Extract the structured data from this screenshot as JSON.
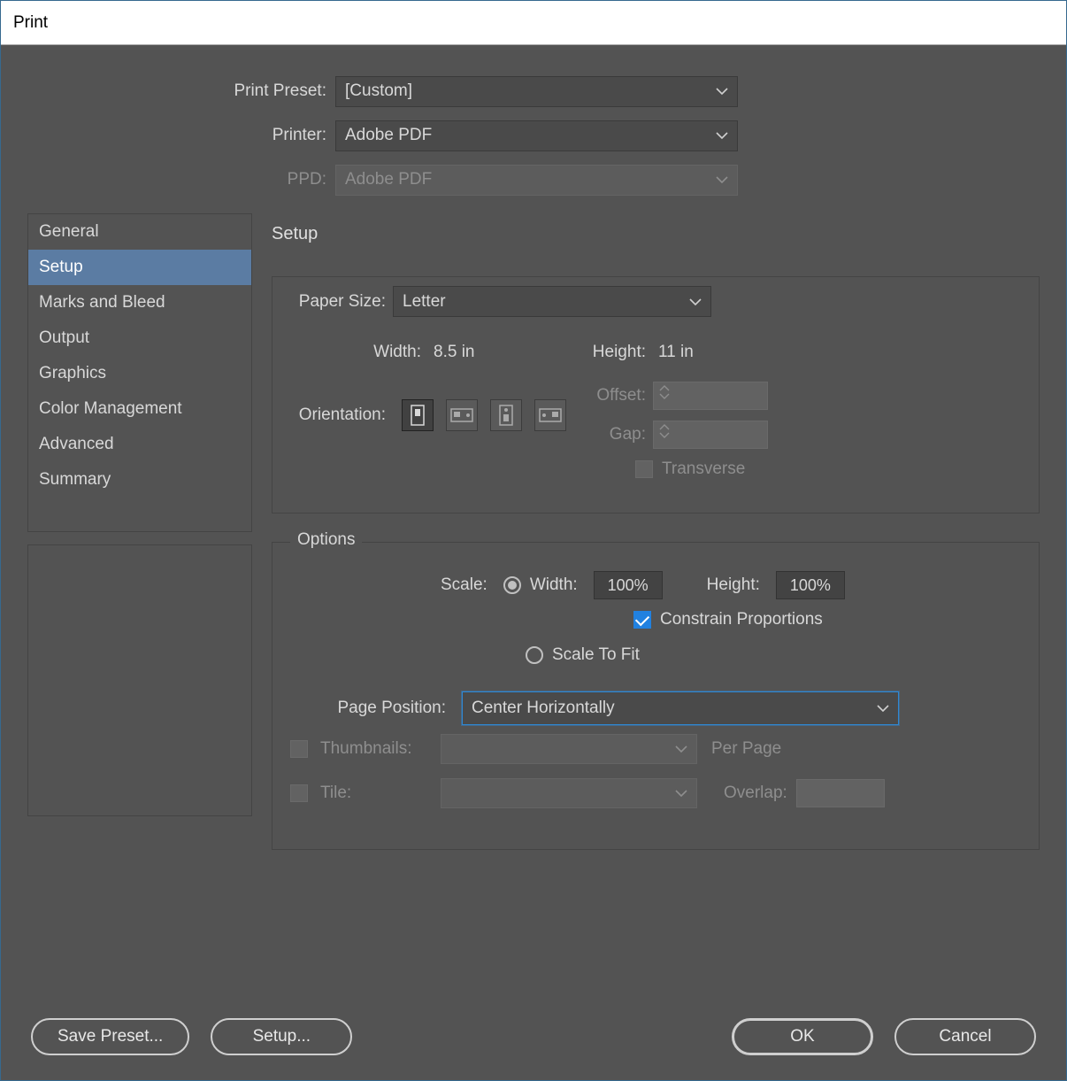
{
  "window": {
    "title": "Print"
  },
  "top": {
    "preset_label": "Print Preset:",
    "preset_value": "[Custom]",
    "printer_label": "Printer:",
    "printer_value": "Adobe PDF",
    "ppd_label": "PPD:",
    "ppd_value": "Adobe PDF"
  },
  "sidebar": {
    "items": [
      "General",
      "Setup",
      "Marks and Bleed",
      "Output",
      "Graphics",
      "Color Management",
      "Advanced",
      "Summary"
    ],
    "selected_index": 1
  },
  "panel": {
    "title": "Setup"
  },
  "setup": {
    "paper_size_label": "Paper Size:",
    "paper_size_value": "Letter",
    "width_label": "Width:",
    "width_value": "8.5 in",
    "height_label": "Height:",
    "height_value": "11 in",
    "orientation_label": "Orientation:",
    "orientation_selected": 0,
    "offset_label": "Offset:",
    "offset_value": "",
    "gap_label": "Gap:",
    "gap_value": "",
    "transverse_label": "Transverse",
    "transverse_checked": false,
    "transverse_enabled": false
  },
  "options": {
    "group_label": "Options",
    "scale_label": "Scale:",
    "scale_mode": "width_height",
    "width_label": "Width:",
    "width_value": "100%",
    "height_label": "Height:",
    "height_value": "100%",
    "constrain_label": "Constrain Proportions",
    "constrain_checked": true,
    "scale_to_fit_label": "Scale To Fit",
    "page_position_label": "Page Position:",
    "page_position_value": "Center Horizontally",
    "thumbnails_label": "Thumbnails:",
    "thumbnails_checked": false,
    "thumbnails_enabled": false,
    "thumbnails_value": "",
    "per_page_label": "Per Page",
    "tile_label": "Tile:",
    "tile_checked": false,
    "tile_enabled": false,
    "tile_value": "",
    "overlap_label": "Overlap:",
    "overlap_value": ""
  },
  "footer": {
    "save_preset": "Save Preset...",
    "setup": "Setup...",
    "ok": "OK",
    "cancel": "Cancel"
  }
}
